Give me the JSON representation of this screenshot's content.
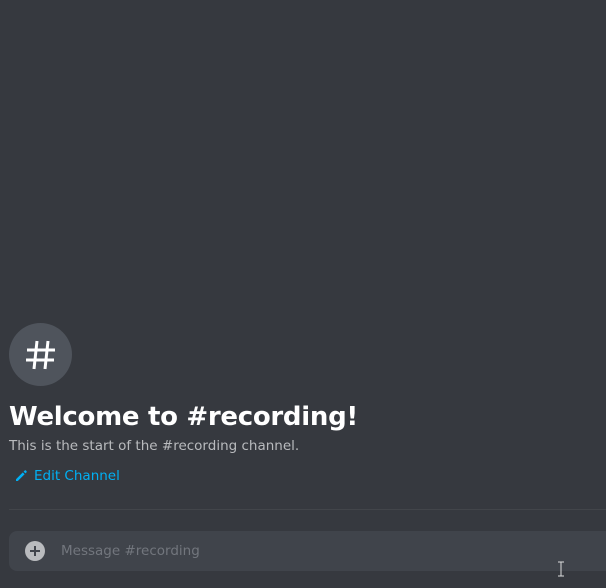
{
  "channel": {
    "name": "recording",
    "hash_symbol": "#",
    "welcome_title": "Welcome to #recording!",
    "welcome_subtitle": "This is the start of the #recording channel.",
    "edit_label": "Edit Channel"
  },
  "composer": {
    "placeholder": "Message #recording",
    "value": ""
  },
  "icons": {
    "channel": "hash-icon",
    "edit": "pencil-icon",
    "attach": "plus-circle-icon",
    "cursor": "text-cursor-icon"
  },
  "colors": {
    "background": "#36393f",
    "accent_link": "#00b0f4",
    "title": "#ffffff",
    "subtitle": "#b9bbbe",
    "composer_bg": "#40444b",
    "avatar_bg": "#4f545c"
  }
}
